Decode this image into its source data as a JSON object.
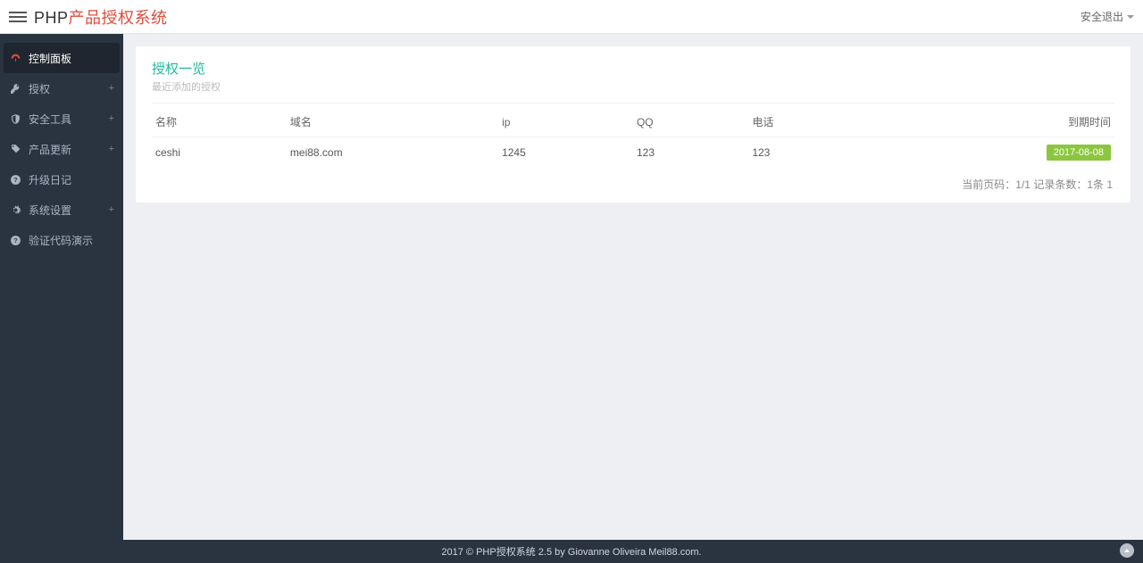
{
  "header": {
    "brand_prefix": "PHP",
    "brand_suffix": "产品授权系统",
    "logout_label": "安全退出"
  },
  "sidebar": {
    "items": [
      {
        "label": "控制面板",
        "icon": "dashboard-icon",
        "active": true
      },
      {
        "label": "授权",
        "icon": "key-icon",
        "expandable": true
      },
      {
        "label": "安全工具",
        "icon": "shield-icon",
        "expandable": true
      },
      {
        "label": "产品更新",
        "icon": "tags-icon",
        "expandable": true
      },
      {
        "label": "升级日记",
        "icon": "help-icon"
      },
      {
        "label": "系统设置",
        "icon": "cogs-icon",
        "expandable": true
      },
      {
        "label": "验证代码演示",
        "icon": "help-icon"
      }
    ]
  },
  "panel": {
    "title": "授权一览",
    "subtitle": "最近添加的授权",
    "columns": [
      "名称",
      "域名",
      "ip",
      "QQ",
      "电话",
      "到期时间"
    ],
    "rows": [
      {
        "name": "ceshi",
        "domain": "mei88.com",
        "ip": "1245",
        "qq": "123",
        "phone": "123",
        "expire": "2017-08-08"
      }
    ],
    "pager": "当前页码：1/1 记录条数：1条 1"
  },
  "footer": {
    "text": "2017 © PHP授权系统 2.5 by Giovanne Oliveira Meil88.com."
  },
  "watermark": ""
}
